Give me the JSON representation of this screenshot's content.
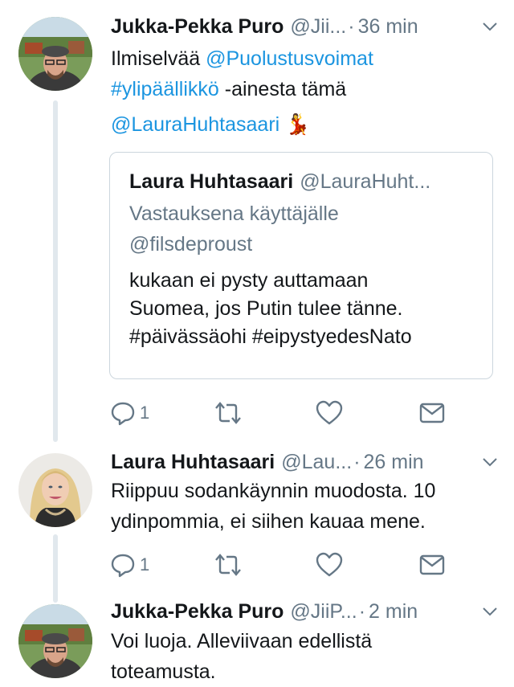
{
  "tweets": [
    {
      "author": "Jukka-Pekka Puro",
      "handle": "@Jii...",
      "time": "36 min",
      "line1_text": "Ilmiselvää ",
      "line1_mention": "@Puolustusvoimat",
      "line2_hashtag": "#ylipäällikkö",
      "line2_text": " -ainesta tämä",
      "line3_mention": "@LauraHuhtasaari",
      "emoji": "💃",
      "reply_count": "1",
      "quoted": {
        "author": "Laura Huhtasaari",
        "handle": "@LauraHuht...",
        "reply_label": "Vastauksena käyttäjälle",
        "reply_to": "@filsdeproust",
        "lines": [
          "kukaan ei pysty auttamaan",
          "Suomea, jos Putin tulee tänne.",
          "#päivässäohi #eipystyedesNato"
        ]
      }
    },
    {
      "author": "Laura Huhtasaari",
      "handle": "@Lau...",
      "time": "26 min",
      "lines": [
        "Riippuu sodankäynnin muodosta. 10",
        "ydinpommia, ei siihen kauaa mene."
      ],
      "reply_count": "1"
    },
    {
      "author": "Jukka-Pekka Puro",
      "handle": "@JiiP...",
      "time": "2 min",
      "lines": [
        "Voi luoja. Alleviivaan edellistä",
        "toteamusta."
      ]
    }
  ],
  "separator": "·",
  "icons": [
    "reply-icon",
    "retweet-icon",
    "like-icon",
    "direct-message-icon",
    "chevron-down-icon"
  ]
}
